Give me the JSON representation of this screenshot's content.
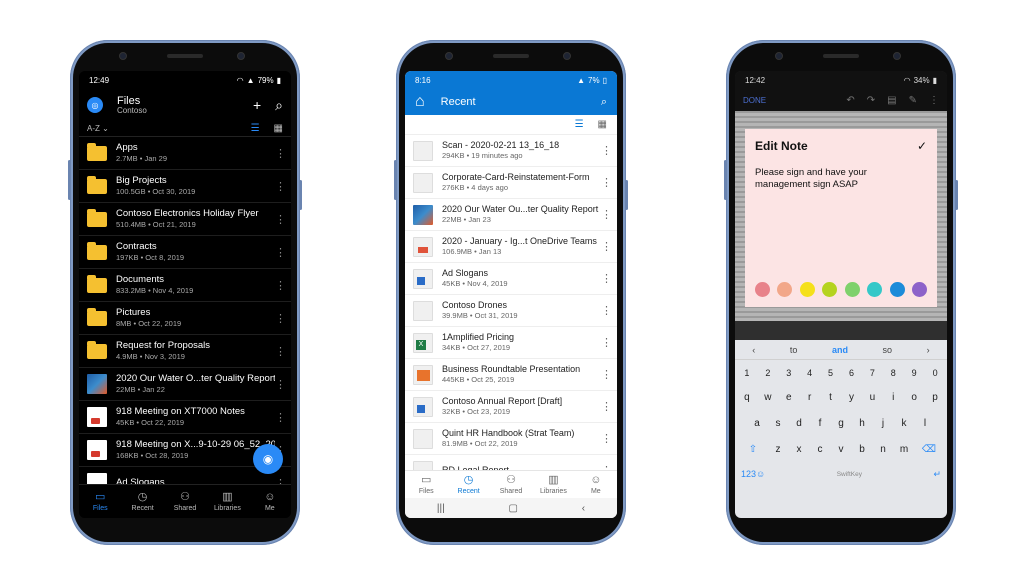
{
  "phone1": {
    "status_time": "12:49",
    "battery": "79%",
    "header_title": "Files",
    "header_subtitle": "Contoso",
    "sort_label": "A-Z",
    "rows": [
      {
        "name": "Apps",
        "sub": "2.7MB • Jan 29",
        "type": "folder"
      },
      {
        "name": "Big Projects",
        "sub": "100.5GB • Oct 30, 2019",
        "type": "folder"
      },
      {
        "name": "Contoso Electronics Holiday Flyer",
        "sub": "510.4MB • Oct 21, 2019",
        "type": "folder"
      },
      {
        "name": "Contracts",
        "sub": "197KB • Oct 8, 2019",
        "type": "folder"
      },
      {
        "name": "Documents",
        "sub": "833.2MB • Nov 4, 2019",
        "type": "folder"
      },
      {
        "name": "Pictures",
        "sub": "8MB • Oct 22, 2019",
        "type": "folder"
      },
      {
        "name": "Request for Proposals",
        "sub": "4.9MB • Nov 3, 2019",
        "type": "folder"
      },
      {
        "name": "2020 Our Water O...ter Quality Report",
        "sub": "22MB • Jan 22",
        "type": "pic"
      },
      {
        "name": "918 Meeting on XT7000 Notes",
        "sub": "45KB • Oct 22, 2019",
        "type": "doc"
      },
      {
        "name": "918 Meeting on X...9-10-29 06_52_20",
        "sub": "168KB • Oct 28, 2019",
        "type": "doc"
      },
      {
        "name": "Ad Slogans",
        "sub": "",
        "type": "doc"
      }
    ],
    "nav": [
      "Files",
      "Recent",
      "Shared",
      "Libraries",
      "Me"
    ]
  },
  "phone2": {
    "status_time": "8:16",
    "battery": "7%",
    "header_title": "Recent",
    "rows": [
      {
        "name": "Scan - 2020-02-21 13_16_18",
        "sub": "294KB • 19 minutes ago",
        "kind": "lt"
      },
      {
        "name": "Corporate-Card-Reinstatement-Form",
        "sub": "276KB • 4 days ago",
        "kind": "lt"
      },
      {
        "name": "2020 Our Water Ou...ter Quality Report",
        "sub": "22MB • Jan 23",
        "kind": "pic"
      },
      {
        "name": "2020 - January - Ig...t OneDrive Teams",
        "sub": "106.9MB • Jan 13",
        "kind": "red2"
      },
      {
        "name": "Ad Slogans",
        "sub": "45KB • Nov 4, 2019",
        "kind": "blue2"
      },
      {
        "name": "Contoso Drones",
        "sub": "39.9MB • Oct 31, 2019",
        "kind": "lt"
      },
      {
        "name": "1Amplified Pricing",
        "sub": "34KB • Oct 27, 2019",
        "kind": "green2"
      },
      {
        "name": "Business Roundtable Presentation",
        "sub": "445KB • Oct 25, 2019",
        "kind": "orange2"
      },
      {
        "name": "Contoso Annual Report [Draft]",
        "sub": "32KB • Oct 23, 2019",
        "kind": "blue2"
      },
      {
        "name": "Quint HR Handbook (Strat Team)",
        "sub": "81.9MB • Oct 22, 2019",
        "kind": "lt"
      },
      {
        "name": "RD Legal Report",
        "sub": "",
        "kind": "lt"
      }
    ],
    "nav": [
      "Files",
      "Recent",
      "Shared",
      "Libraries",
      "Me"
    ]
  },
  "phone3": {
    "status_time": "12:42",
    "battery": "34%",
    "toolbar_done": "DONE",
    "note_title": "Edit Note",
    "note_body": "Please sign and have your management sign ASAP",
    "swatch_colors": [
      "#e8828a",
      "#f2a789",
      "#f5e01a",
      "#b5d31f",
      "#7fd16b",
      "#35c8c8",
      "#1c8bd9",
      "#8d62c9"
    ],
    "suggestions": [
      "to",
      "and",
      "so"
    ],
    "number_row": [
      "1",
      "2",
      "3",
      "4",
      "5",
      "6",
      "7",
      "8",
      "9",
      "0"
    ],
    "row1": [
      "q",
      "w",
      "e",
      "r",
      "t",
      "y",
      "u",
      "i",
      "o",
      "p"
    ],
    "row2": [
      "a",
      "s",
      "d",
      "f",
      "g",
      "h",
      "j",
      "k",
      "l"
    ],
    "row3": [
      "z",
      "x",
      "c",
      "v",
      "b",
      "n",
      "m"
    ],
    "num_key": "123",
    "space_label": "SwiftKey"
  },
  "colors": {
    "accent_dark": "#2a8af6",
    "accent_light": "#0a78d4",
    "folder": "#f5c030"
  }
}
